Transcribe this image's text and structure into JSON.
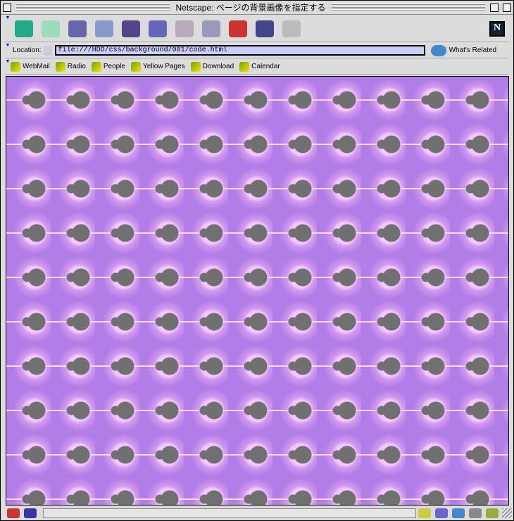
{
  "window": {
    "title": "Netscape: ページの背景画像を指定する"
  },
  "toolbar": {
    "buttons": [
      "back",
      "forward",
      "reload",
      "home",
      "search",
      "my-netscape",
      "images",
      "print",
      "security",
      "shop",
      "stop"
    ]
  },
  "location": {
    "label": "Location:",
    "url": "file:///HDD/css/background/001/code.html",
    "related": "What's Related"
  },
  "personal_bar": {
    "items": [
      "WebMail",
      "Radio",
      "People",
      "Yellow Pages",
      "Download",
      "Calendar"
    ]
  },
  "colors": {
    "background": "#b27de6",
    "fractal": "#707070"
  }
}
